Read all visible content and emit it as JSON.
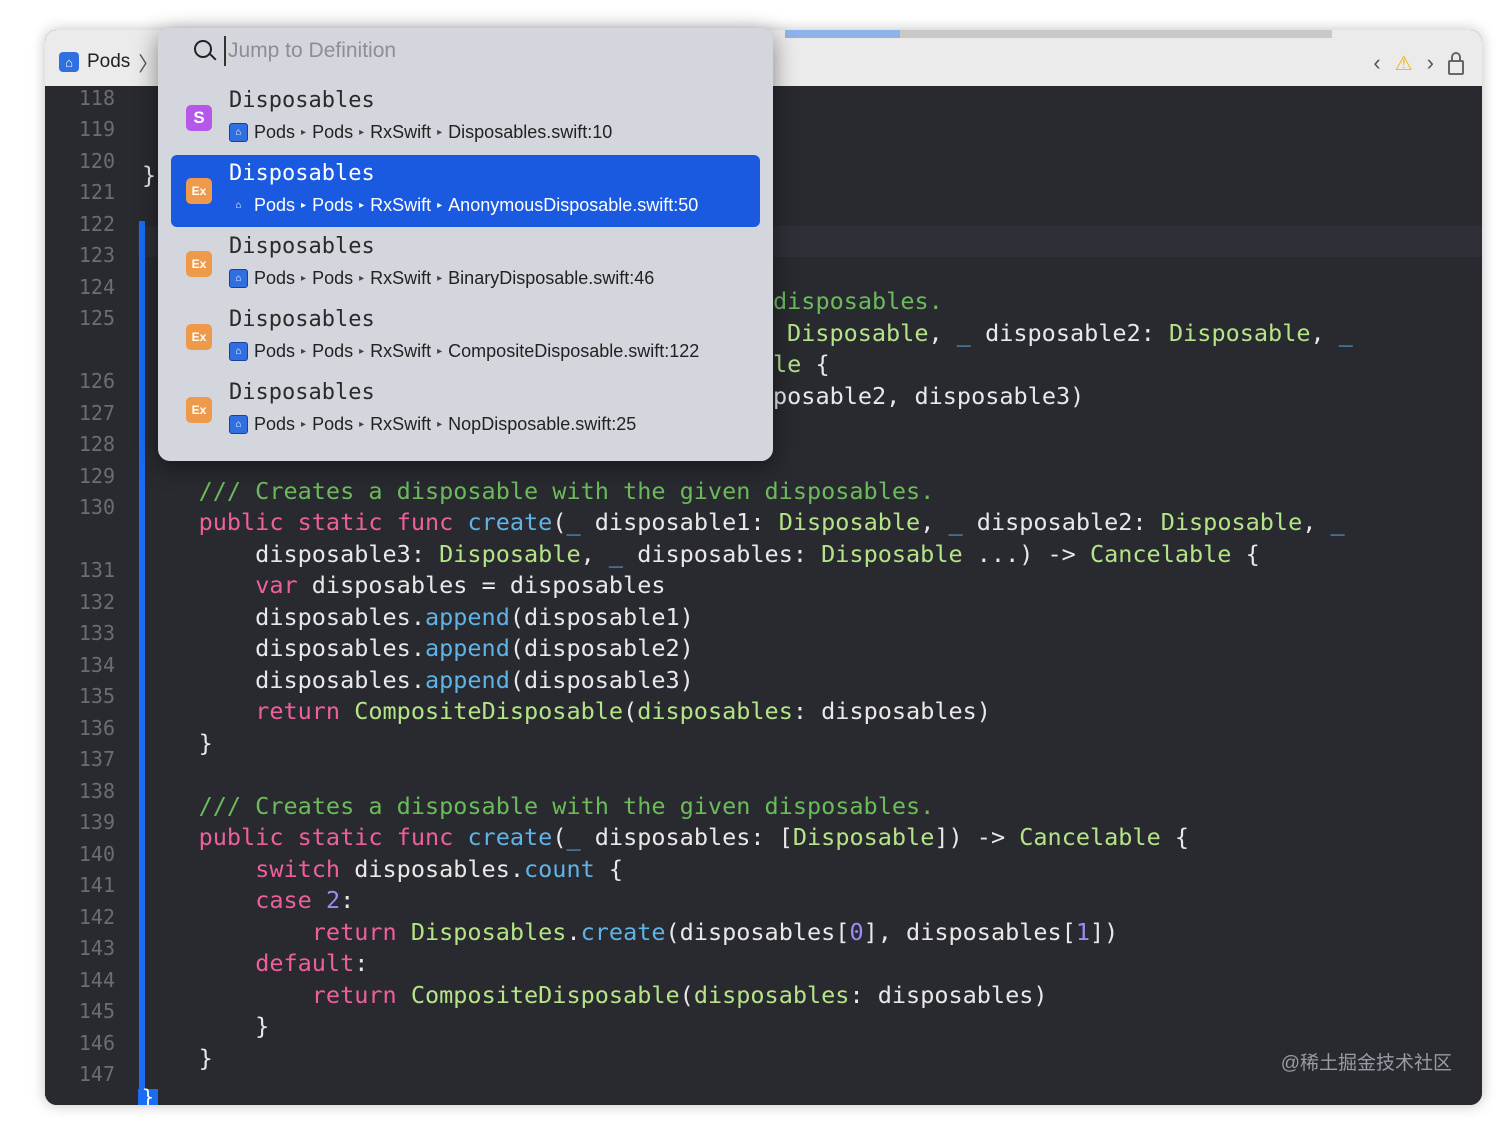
{
  "toolbar": {
    "breadcrumb_label": "Pods",
    "nav_back": "‹",
    "nav_forward": "›",
    "warning_symbol": "⚠"
  },
  "popup": {
    "search_placeholder": "Jump to Definition",
    "results": [
      {
        "icon": "S",
        "name": "Disposables",
        "path": [
          "Pods",
          "Pods",
          "RxSwift",
          "Disposables.swift:10"
        ],
        "selected": false
      },
      {
        "icon": "Ex",
        "name": "Disposables",
        "path": [
          "Pods",
          "Pods",
          "RxSwift",
          "AnonymousDisposable.swift:50"
        ],
        "selected": true
      },
      {
        "icon": "Ex",
        "name": "Disposables",
        "path": [
          "Pods",
          "Pods",
          "RxSwift",
          "BinaryDisposable.swift:46"
        ],
        "selected": false
      },
      {
        "icon": "Ex",
        "name": "Disposables",
        "path": [
          "Pods",
          "Pods",
          "RxSwift",
          "CompositeDisposable.swift:122"
        ],
        "selected": false
      },
      {
        "icon": "Ex",
        "name": "Disposables",
        "path": [
          "Pods",
          "Pods",
          "RxSwift",
          "NopDisposable.swift:25"
        ],
        "selected": false
      }
    ]
  },
  "gutter": {
    "line_numbers": [
      "118",
      "119",
      "120",
      "121",
      "122",
      "123",
      "124",
      "125",
      "126",
      "127",
      "128",
      "129",
      "130",
      "131",
      "132",
      "133",
      "134",
      "135",
      "136",
      "137",
      "138",
      "139",
      "140",
      "141",
      "142",
      "143",
      "144",
      "145",
      "146",
      "147"
    ]
  },
  "code": {
    "l120": "}",
    "l124_tail": "disposables.",
    "l125_a": "Disposable",
    "l125_b": ", ",
    "l125_c": "_",
    "l125_d": " disposable2: ",
    "l125_e": "Disposable",
    "l125_f": ", ",
    "l125_g": "_",
    "l125b_tail": "le {",
    "l126_tail": "posable2, disposable3)",
    "comment": "/// Creates a disposable with the given disposables.",
    "kw_public": "public",
    "kw_static": "static",
    "kw_func": "func",
    "fn_create": "create",
    "kw_var": "var",
    "kw_return": "return",
    "kw_switch": "switch",
    "kw_case": "case",
    "kw_default": "default",
    "ty_disposable": "Disposable",
    "ty_cancelable": "Cancelable",
    "ty_composite": "CompositeDisposable",
    "ty_disposables": "Disposables",
    "fn_append": "append",
    "fn_count": "count",
    "arg_label": "disposables",
    "num_0": "0",
    "num_1": "1",
    "num_2": "2",
    "closing_brace": "}"
  },
  "watermark": "@稀土掘金技术社区"
}
